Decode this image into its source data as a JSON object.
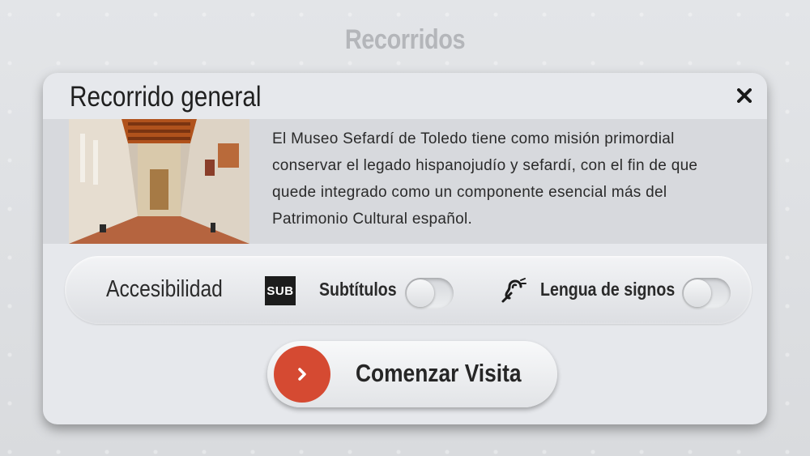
{
  "page": {
    "title": "Recorridos"
  },
  "modal": {
    "title": "Recorrido general",
    "close_icon": "close-icon",
    "photo_icon": "museum-interior-image",
    "description": "El Museo Sefardí de Toledo tiene como misión primordial conservar el legado hispanojudío y sefardí, con el fin de que quede integrado como un componente esencial más del Patrimonio Cultural español."
  },
  "accessibility": {
    "label": "Accesibilidad",
    "subtitles": {
      "icon_text": "SUB",
      "label": "Subtítulos",
      "enabled": false
    },
    "sign_language": {
      "icon": "hearing-assist-icon",
      "label": "Lengua de signos",
      "enabled": false
    }
  },
  "start_button": {
    "label": "Comenzar Visita",
    "icon": "chevron-right-icon",
    "accent": "#d54a32"
  }
}
